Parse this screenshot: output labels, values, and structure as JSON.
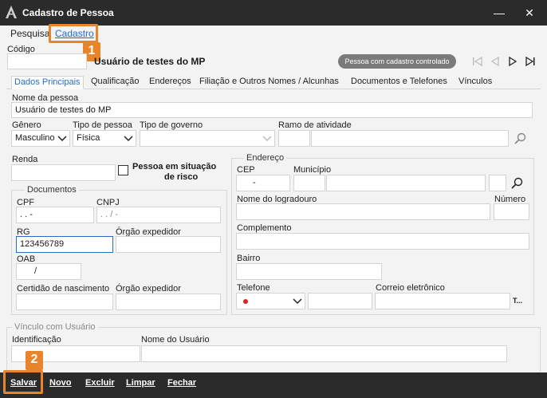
{
  "window": {
    "title": "Cadastro de Pessoa"
  },
  "top_tabs": {
    "pesquisa": "Pesquisa",
    "cadastro": "Cadastro"
  },
  "callouts": {
    "one": "1",
    "two": "2"
  },
  "header": {
    "codigo_label": "Código",
    "person_name": "Usuário de testes do MP",
    "pill": "Pessoa com cadastro controlado"
  },
  "subtabs": [
    "Dados Principais",
    "Qualificação",
    "Endereços",
    "Filiação e Outros Nomes / Alcunhas",
    "Documentos e Telefones",
    "Vínculos"
  ],
  "form": {
    "nome_label": "Nome da pessoa",
    "nome_value": "Usuário de testes do MP",
    "genero_label": "Gênero",
    "genero_value": "Masculino",
    "tipo_pessoa_label": "Tipo de pessoa",
    "tipo_pessoa_value": "Física",
    "tipo_governo_label": "Tipo de governo",
    "ramo_label": "Ramo de atividade",
    "renda_label": "Renda",
    "risco_label_1": "Pessoa em situação",
    "risco_label_2": "de risco",
    "documentos": {
      "group_label": "Documentos",
      "cpf_label": "CPF",
      "cpf_value": ". . -",
      "cnpj_label": "CNPJ",
      "cnpj_value": ". . / -",
      "rg_label": "RG",
      "rg_value": "123456789",
      "orgao_label": "Órgão expedidor",
      "oab_label": "OAB",
      "oab_value": "/",
      "certidao_label": "Certidão de nascimento",
      "orgao2_label": "Órgão expedidor"
    },
    "endereco": {
      "group_label": "Endereço",
      "cep_label": "CEP",
      "cep_value": "-",
      "municipio_label": "Município",
      "logradouro_label": "Nome do logradouro",
      "numero_label": "Número",
      "complemento_label": "Complemento",
      "bairro_label": "Bairro",
      "telefone_label": "Telefone",
      "email_label": "Correio eletrônico",
      "email_suffix": "T..."
    },
    "vinculo": {
      "group_label": "Vínculo com Usuário",
      "identificacao_label": "Identificação",
      "nome_usuario_label": "Nome do Usuário"
    }
  },
  "bottom": {
    "salvar": "Salvar",
    "novo": "Novo",
    "excluir": "Excluir",
    "limpar": "Limpar",
    "fechar": "Fechar"
  },
  "colors": {
    "accent": "#2a6ac7",
    "callout": "#e8842a",
    "bar": "#2b2b2b",
    "flag_dot": "#e02020"
  },
  "icons": [
    "app-logo-icon",
    "minimize-icon",
    "close-icon",
    "first-record-icon",
    "prev-record-icon",
    "next-record-icon",
    "last-record-icon",
    "search-icon",
    "chevron-down-icon",
    "phone-country-flag-icon"
  ]
}
